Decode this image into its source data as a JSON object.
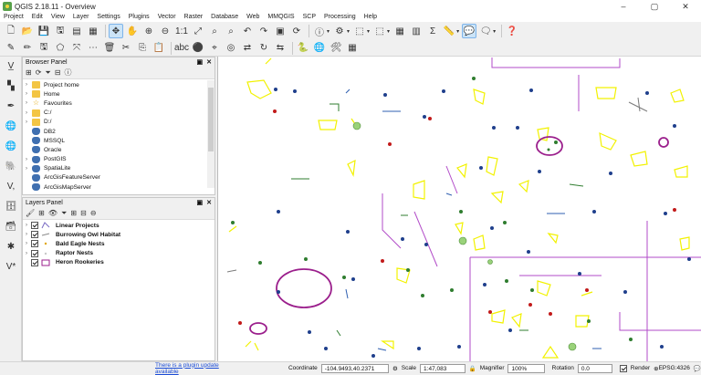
{
  "window": {
    "title": "QGIS 2.18.11 - Overview",
    "controls": [
      "–",
      "▢",
      "✕"
    ]
  },
  "menu": [
    "Project",
    "Edit",
    "View",
    "Layer",
    "Settings",
    "Plugins",
    "Vector",
    "Raster",
    "Database",
    "Web",
    "MMQGIS",
    "SCP",
    "Processing",
    "Help"
  ],
  "browser_panel": {
    "title": "Browser Panel",
    "items": [
      {
        "label": "Project home",
        "icon": "folder-icon"
      },
      {
        "label": "Home",
        "icon": "folder-icon"
      },
      {
        "label": "Favourites",
        "icon": "star-icon"
      },
      {
        "label": "C:/",
        "icon": "folder-icon"
      },
      {
        "label": "D:/",
        "icon": "folder-icon"
      },
      {
        "label": "DB2",
        "icon": "database-icon"
      },
      {
        "label": "MSSQL",
        "icon": "database-icon"
      },
      {
        "label": "Oracle",
        "icon": "database-icon"
      },
      {
        "label": "PostGIS",
        "icon": "database-icon"
      },
      {
        "label": "SpatiaLite",
        "icon": "database-icon"
      },
      {
        "label": "ArcGisFeatureServer",
        "icon": "globe-icon"
      },
      {
        "label": "ArcGisMapServer",
        "icon": "globe-icon"
      }
    ]
  },
  "layers_panel": {
    "title": "Layers Panel",
    "layers": [
      {
        "name": "Linear Projects",
        "checked": true,
        "symbol": "line",
        "color": "#7b6cc4"
      },
      {
        "name": "Burrowing Owl Habitat",
        "checked": true,
        "symbol": "line",
        "color": "#8a8a8a"
      },
      {
        "name": "Bald Eagle Nests",
        "checked": true,
        "symbol": "point",
        "color": "#e0a500"
      },
      {
        "name": "Raptor Nests",
        "checked": true,
        "symbol": "point",
        "color": "#c8c8c8"
      },
      {
        "name": "Heron Rookeries",
        "checked": true,
        "symbol": "polygon",
        "color": "#9b1f8c"
      }
    ]
  },
  "status": {
    "plugin_update": "There is a plugin update available",
    "coordinate_label": "Coordinate",
    "coordinate": "-104.9493,40.2371",
    "scale_label": "Scale",
    "scale": "1:47,083",
    "magnifier_label": "Magnifier",
    "magnifier": "100%",
    "rotation_label": "Rotation",
    "rotation": "0.0",
    "render_label": "Render",
    "crs": "EPSG:4326"
  },
  "map_colors": {
    "yellow": "#ffff00",
    "purple": "#9b1f8c",
    "magenta": "#c000c0",
    "blue": "#1f3f8c",
    "red": "#c21a1a",
    "green": "#2f7d2f",
    "lightgreen": "#9ad27a",
    "gray": "#a0a0a0"
  }
}
